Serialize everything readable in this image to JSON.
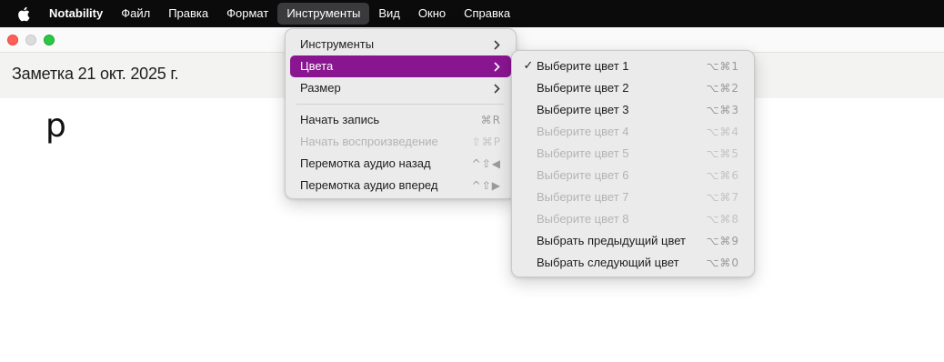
{
  "menubar": {
    "apple_icon": "apple-icon",
    "app_name": "Notability",
    "items": [
      "Файл",
      "Правка",
      "Формат",
      "Инструменты",
      "Вид",
      "Окно",
      "Справка"
    ],
    "active_item": "Инструменты"
  },
  "window": {
    "note_title": "Заметка 21 окт. 2025 г.",
    "note_text": "p"
  },
  "tools_menu": {
    "items": [
      {
        "label": "Инструменты",
        "submenu": true
      },
      {
        "label": "Цвета",
        "submenu": true,
        "highlighted": true
      },
      {
        "label": "Размер",
        "submenu": true
      },
      {
        "label": "Начать запись",
        "shortcut": "⌘R"
      },
      {
        "label": "Начать воспроизведение",
        "shortcut": "⇧⌘P",
        "disabled": true
      },
      {
        "label": "Перемотка аудио назад",
        "shortcut": "^⇧◀"
      },
      {
        "label": "Перемотка аудио вперед",
        "shortcut": "^⇧▶"
      }
    ]
  },
  "colors_menu": {
    "items": [
      {
        "label": "Выберите цвет 1",
        "shortcut": "⌥⌘1",
        "checked": true
      },
      {
        "label": "Выберите цвет 2",
        "shortcut": "⌥⌘2"
      },
      {
        "label": "Выберите цвет 3",
        "shortcut": "⌥⌘3"
      },
      {
        "label": "Выберите цвет 4",
        "shortcut": "⌥⌘4",
        "disabled": true
      },
      {
        "label": "Выберите цвет 5",
        "shortcut": "⌥⌘5",
        "disabled": true
      },
      {
        "label": "Выберите цвет 6",
        "shortcut": "⌥⌘6",
        "disabled": true
      },
      {
        "label": "Выберите цвет 7",
        "shortcut": "⌥⌘7",
        "disabled": true
      },
      {
        "label": "Выберите цвет 8",
        "shortcut": "⌥⌘8",
        "disabled": true
      },
      {
        "label": "Выбрать предыдущий цвет",
        "shortcut": "⌥⌘9"
      },
      {
        "label": "Выбрать следующий цвет",
        "shortcut": "⌥⌘0"
      }
    ]
  },
  "colors": {
    "highlight": "#8a1590",
    "close": "#ff5f57",
    "zoom": "#28c840"
  }
}
